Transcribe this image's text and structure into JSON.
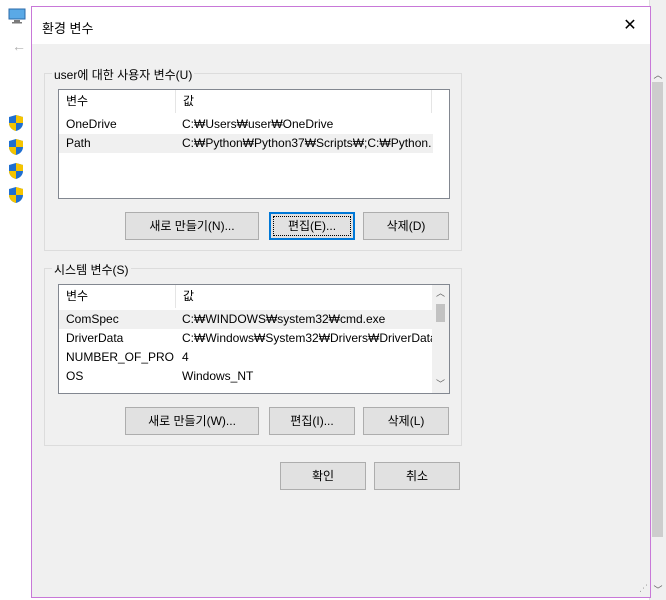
{
  "dialog": {
    "title": "환경 변수",
    "close_glyph": "✕"
  },
  "user_vars": {
    "group_label": "user에 대한 사용자 변수(U)",
    "col_variable": "변수",
    "col_value": "값",
    "rows": [
      {
        "name": "OneDrive",
        "value": "C:₩Users₩user₩OneDrive"
      },
      {
        "name": "Path",
        "value": "C:₩Python₩Python37₩Scripts₩;C:₩Python..."
      }
    ],
    "selected_row": 1,
    "new_button": "새로 만들기(N)...",
    "edit_button": "편집(E)...",
    "delete_button": "삭제(D)"
  },
  "system_vars": {
    "group_label": "시스템 변수(S)",
    "col_variable": "변수",
    "col_value": "값",
    "rows": [
      {
        "name": "ComSpec",
        "value": "C:₩WINDOWS₩system32₩cmd.exe"
      },
      {
        "name": "DriverData",
        "value": "C:₩Windows₩System32₩Drivers₩DriverData"
      },
      {
        "name": "NUMBER_OF_PRO...",
        "value": "4"
      },
      {
        "name": "OS",
        "value": "Windows_NT"
      }
    ],
    "selected_row": 0,
    "new_button": "새로 만들기(W)...",
    "edit_button": "편집(I)...",
    "delete_button": "삭제(L)"
  },
  "footer": {
    "ok_button": "확인",
    "cancel_button": "취소"
  },
  "icons": {
    "scroll_up": "▲",
    "scroll_down": "▼",
    "chevron_up": "︿",
    "chevron_down": "﹀",
    "back_arrow": "←",
    "grip": "⋰"
  },
  "colors": {
    "dialog_border": "#c878d8",
    "default_button_border": "#0078d7",
    "shield_blue": "#1f6fd0",
    "shield_yellow": "#f5c400"
  }
}
